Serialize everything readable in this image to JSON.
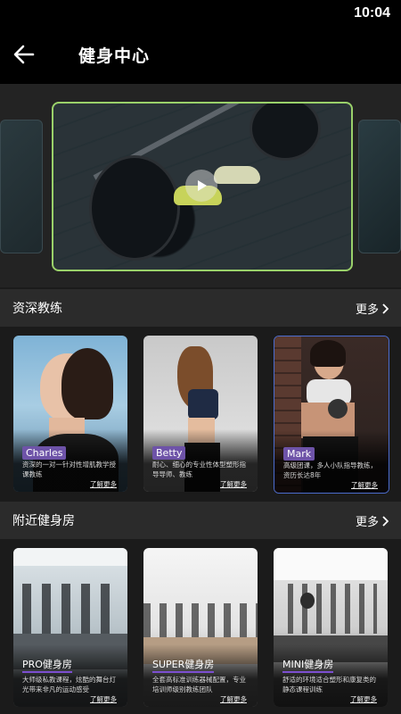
{
  "status_bar": {
    "time": "10:04"
  },
  "header": {
    "title": "健身中心"
  },
  "coaches_section": {
    "title": "资深教练",
    "more": "更多",
    "items": [
      {
        "name": "Charles",
        "desc": "资深的一对一针对性增肌教学授课教练",
        "link": "了解更多"
      },
      {
        "name": "Betty",
        "desc": "耐心、细心的专业性体型塑形指导导师、教练",
        "link": "了解更多"
      },
      {
        "name": "Mark",
        "desc": "高级团课，多人小队指导教练，资历长达8年",
        "link": "了解更多"
      }
    ]
  },
  "gyms_section": {
    "title": "附近健身房",
    "more": "更多",
    "items": [
      {
        "name": "PRO健身房",
        "desc": "大师级私教课程，炫酷的舞台灯光带来非凡的运动感受",
        "link": "了解更多"
      },
      {
        "name": "SUPER健身房",
        "desc": "全套高标准训练器械配置，专业培训师级别教练团队",
        "link": "了解更多"
      },
      {
        "name": "MINI健身房",
        "desc": "舒适的环境适合塑形和康复类的静态课程训练",
        "link": "了解更多"
      }
    ]
  },
  "icons": {
    "back": "arrow-left-icon",
    "play": "play-icon",
    "more": "chevron-right-icon"
  },
  "colors": {
    "accent": "#6e53a8",
    "banner_border": "#9ad16a"
  }
}
